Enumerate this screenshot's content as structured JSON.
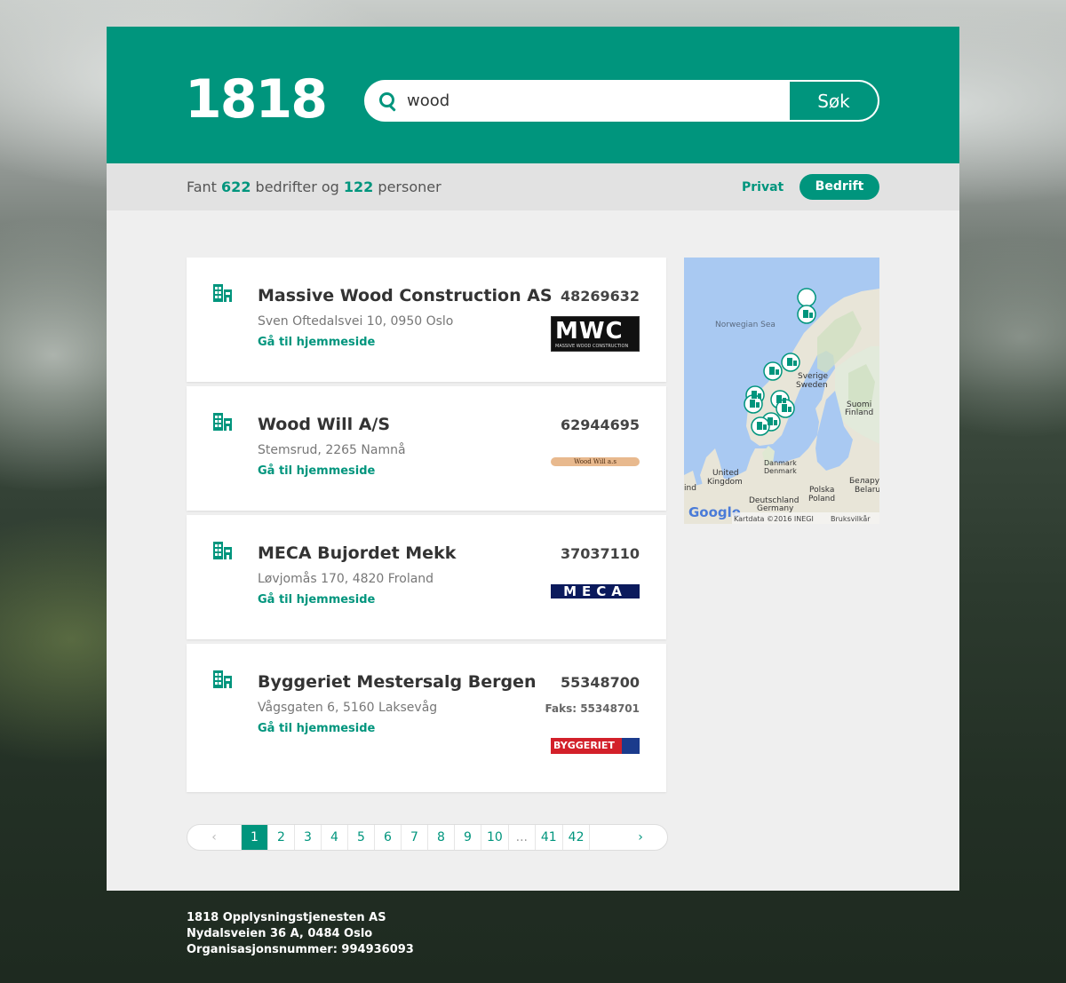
{
  "header": {
    "logo": "1818",
    "search_value": "wood",
    "search_button": "Søk"
  },
  "subbar": {
    "prefix": "Fant",
    "companies_count": "622",
    "middle": "bedrifter og",
    "persons_count": "122",
    "suffix": "personer",
    "filter_privat": "Privat",
    "filter_bedrift": "Bedrift"
  },
  "results": [
    {
      "name": "Massive Wood Construction AS",
      "address": "Sven Oftedalsvei 10, 0950 Oslo",
      "link": "Gå til hjemmeside",
      "phone": "48269632",
      "logo_text": "MWC",
      "logo_subtext": "MASSIVE WOOD CONSTRUCTION"
    },
    {
      "name": "Wood Will A/S",
      "address": "Stemsrud, 2265 Namnå",
      "link": "Gå til hjemmeside",
      "phone": "62944695",
      "logo_text": "Wood Will a.s"
    },
    {
      "name": "MECA Bujordet Mekk",
      "address": "Løvjomås 170, 4820 Froland",
      "link": "Gå til hjemmeside",
      "phone": "37037110",
      "logo_text": "MECA"
    },
    {
      "name": "Byggeriet Mestersalg Bergen",
      "address": "Vågsgaten 6, 5160 Laksevåg",
      "link": "Gå til hjemmeside",
      "phone": "55348700",
      "fax": "Faks: 55348701",
      "logo_text": "BYGGERIET"
    }
  ],
  "map": {
    "labels": {
      "sea": "Norwegian Sea",
      "sverige": "Sverige",
      "sweden": "Sweden",
      "suomi": "Suomi",
      "finland": "Finland",
      "danmark1": "Danmark",
      "danmark2": "Denmark",
      "uk1": "United",
      "uk2": "Kingdom",
      "polska": "Polska",
      "poland": "Poland",
      "deutschland": "Deutschland",
      "germany": "Germany",
      "belarus1": "Белару",
      "belarus2": "Belaru",
      "ireland": "ind",
      "google": "Google",
      "attribution": "Kartdata ©2016 INEGI",
      "terms": "Bruksvilkår"
    }
  },
  "pagination": {
    "prev": "‹",
    "next": "›",
    "pages": [
      "1",
      "2",
      "3",
      "4",
      "5",
      "6",
      "7",
      "8",
      "9",
      "10",
      "...",
      "41",
      "42"
    ],
    "active": "1"
  },
  "footer": {
    "line1": "1818 Opplysningstjenesten AS",
    "line2": "Nydalsveien 36 A, 0484 Oslo",
    "line3": "Organisasjonsnummer: 994936093"
  },
  "colors": {
    "brand": "#00957d",
    "panel": "#efefef",
    "subbar": "#e2e2e2"
  }
}
